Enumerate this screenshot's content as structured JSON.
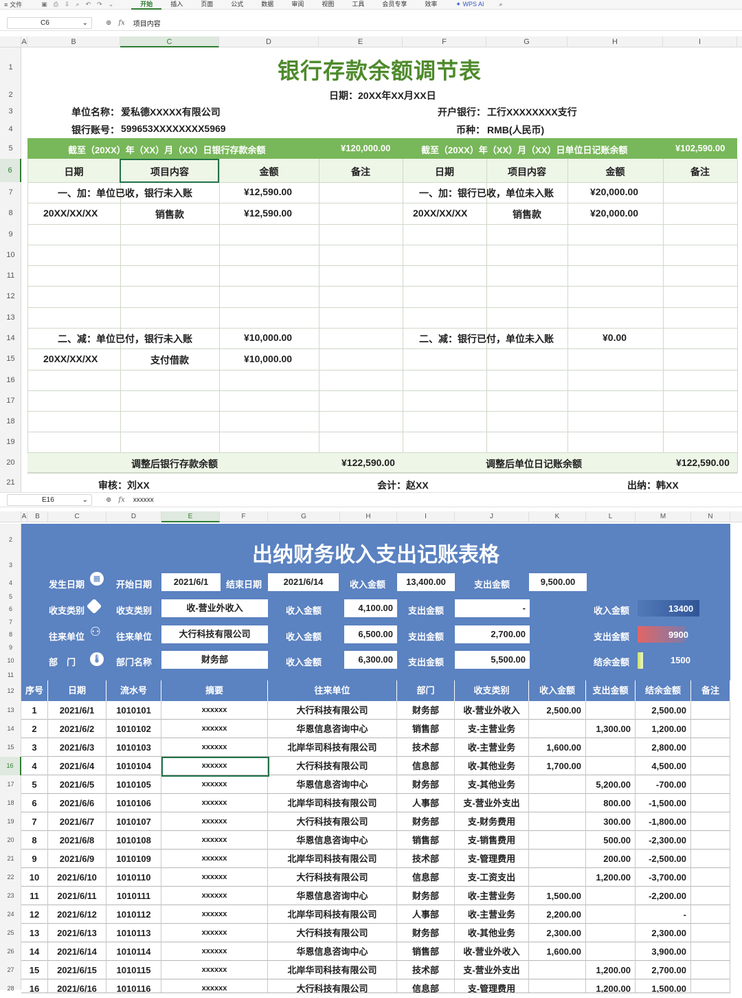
{
  "app": {
    "menu_label": "文件",
    "tabs": [
      "开始",
      "插入",
      "页面",
      "公式",
      "数据",
      "审阅",
      "视图",
      "工具",
      "会员专享",
      "效率"
    ],
    "active_tab": "开始",
    "ai_label": "WPS AI"
  },
  "sheet1": {
    "formula_bar": {
      "cell": "C6",
      "content": "项目内容"
    },
    "columns": [
      "A",
      "B",
      "C",
      "D",
      "E",
      "F",
      "G",
      "H",
      "I"
    ],
    "selected_column": "C",
    "rows": [
      "1",
      "2",
      "3",
      "4",
      "5",
      "6",
      "7",
      "8",
      "9",
      "10",
      "11",
      "12",
      "13",
      "14",
      "15",
      "16",
      "17",
      "18",
      "19",
      "20",
      "21"
    ],
    "selected_row": "6",
    "title": "银行存款余额调节表",
    "date_line": "日期：20XX年XX月XX日",
    "company_label": "单位名称：",
    "company_value": "爱私德XXXXX有限公司",
    "account_label": "银行账号：",
    "account_value": "599653XXXXXXXX5969",
    "bank_label": "开户银行：",
    "bank_value": "工行XXXXXXXX支行",
    "currency_label": "币种：",
    "currency_value": "RMB(人民币)",
    "bank_balance_label": "截至（20XX）年（XX）月（XX）日银行存款余额",
    "bank_balance_value": "¥120,000.00",
    "book_balance_label": "截至（20XX）年（XX）月（XX）日单位日记账余额",
    "book_balance_value": "¥102,590.00",
    "headers": [
      "日期",
      "项目内容",
      "金额",
      "备注",
      "日期",
      "项目内容",
      "金额",
      "备注"
    ],
    "add_left": "一、加：单位已收，银行未入账",
    "add_left_amount": "¥12,590.00",
    "add_right": "一、加：银行已收，单位未入账",
    "add_right_amount": "¥20,000.00",
    "row8": {
      "date_l": "20XX/XX/XX",
      "item_l": "销售款",
      "amt_l": "¥12,590.00",
      "date_r": "20XX/XX/XX",
      "item_r": "销售款",
      "amt_r": "¥20,000.00"
    },
    "sub_left": "二、减：单位已付，银行未入账",
    "sub_left_amount": "¥10,000.00",
    "sub_right": "二、减：银行已付，单位未入账",
    "sub_right_amount": "¥0.00",
    "row15": {
      "date_l": "20XX/XX/XX",
      "item_l": "支付借款",
      "amt_l": "¥10,000.00"
    },
    "adj_bank_label": "调整后银行存款余额",
    "adj_bank_value": "¥122,590.00",
    "adj_book_label": "调整后单位日记账余额",
    "adj_book_value": "¥122,590.00",
    "audit": "审核：刘XX",
    "accountant": "会计：赵XX",
    "cashier": "出纳：韩XX"
  },
  "sheet2": {
    "formula_bar": {
      "cell": "E16",
      "content": "xxxxxx"
    },
    "columns": [
      "A",
      "B",
      "C",
      "D",
      "E",
      "F",
      "G",
      "H",
      "I",
      "J",
      "K",
      "L",
      "M",
      "N"
    ],
    "selected_column": "E",
    "title": "出纳财务收入支出记账表格",
    "occur_date_label": "发生日期",
    "category_label": "收支类别",
    "partner_label": "往来单位",
    "dept_label": "部　门",
    "start_date_label": "开始日期",
    "start_date": "2021/6/1",
    "end_date_label": "结束日期",
    "end_date": "2021/6/14",
    "income_label": "收入金额",
    "income_total": "13,400.00",
    "expense_label": "支出金额",
    "expense_total": "9,500.00",
    "type_label": "收支类别",
    "type_value": "收-营业外收入",
    "type_income": "4,100.00",
    "type_expense": "-",
    "unit_label": "往来单位",
    "unit_value": "大行科技有限公司",
    "unit_income": "6,500.00",
    "unit_expense": "2,700.00",
    "deptname_label": "部门名称",
    "dept_value": "财务部",
    "dept_income": "6,300.00",
    "dept_expense": "5,500.00",
    "g_income_label": "收入金额",
    "g_income_value": "13400",
    "g_expense_label": "支出金额",
    "g_expense_value": "9900",
    "g_balance_label": "结余金额",
    "g_balance_value": "1500",
    "gauge_colors": {
      "income": "#2f5597",
      "expense": "#e06666",
      "balance": "#c9e265"
    },
    "table_headers": [
      "序号",
      "日期",
      "流水号",
      "摘要",
      "往来单位",
      "部门",
      "收支类别",
      "收入金额",
      "支出金额",
      "结余金额",
      "备注"
    ],
    "row_numbers": [
      "11",
      "12",
      "13",
      "14",
      "15",
      "16",
      "17",
      "18",
      "19",
      "20",
      "21",
      "22",
      "23",
      "24",
      "25",
      "26",
      "27",
      "28"
    ],
    "rows": [
      [
        "1",
        "2021/6/1",
        "1010101",
        "xxxxxx",
        "大行科技有限公司",
        "财务部",
        "收-营业外收入",
        "2,500.00",
        "",
        "2,500.00",
        ""
      ],
      [
        "2",
        "2021/6/2",
        "1010102",
        "xxxxxx",
        "华恩信息咨询中心",
        "销售部",
        "支-主营业务",
        "",
        "1,300.00",
        "1,200.00",
        ""
      ],
      [
        "3",
        "2021/6/3",
        "1010103",
        "xxxxxx",
        "北岸华司科技有限公司",
        "技术部",
        "收-主营业务",
        "1,600.00",
        "",
        "2,800.00",
        ""
      ],
      [
        "4",
        "2021/6/4",
        "1010104",
        "xxxxxx",
        "大行科技有限公司",
        "信息部",
        "收-其他业务",
        "1,700.00",
        "",
        "4,500.00",
        ""
      ],
      [
        "5",
        "2021/6/5",
        "1010105",
        "xxxxxx",
        "华恩信息咨询中心",
        "财务部",
        "支-其他业务",
        "",
        "5,200.00",
        "-700.00",
        ""
      ],
      [
        "6",
        "2021/6/6",
        "1010106",
        "xxxxxx",
        "北岸华司科技有限公司",
        "人事部",
        "支-营业外支出",
        "",
        "800.00",
        "-1,500.00",
        ""
      ],
      [
        "7",
        "2021/6/7",
        "1010107",
        "xxxxxx",
        "大行科技有限公司",
        "财务部",
        "支-财务费用",
        "",
        "300.00",
        "-1,800.00",
        ""
      ],
      [
        "8",
        "2021/6/8",
        "1010108",
        "xxxxxx",
        "华恩信息咨询中心",
        "销售部",
        "支-销售费用",
        "",
        "500.00",
        "-2,300.00",
        ""
      ],
      [
        "9",
        "2021/6/9",
        "1010109",
        "xxxxxx",
        "北岸华司科技有限公司",
        "技术部",
        "支-管理费用",
        "",
        "200.00",
        "-2,500.00",
        ""
      ],
      [
        "10",
        "2021/6/10",
        "1010110",
        "xxxxxx",
        "大行科技有限公司",
        "信息部",
        "支-工资支出",
        "",
        "1,200.00",
        "-3,700.00",
        ""
      ],
      [
        "11",
        "2021/6/11",
        "1010111",
        "xxxxxx",
        "华恩信息咨询中心",
        "财务部",
        "收-主营业务",
        "1,500.00",
        "",
        "-2,200.00",
        ""
      ],
      [
        "12",
        "2021/6/12",
        "1010112",
        "xxxxxx",
        "北岸华司科技有限公司",
        "人事部",
        "收-主营业务",
        "2,200.00",
        "",
        "-",
        ""
      ],
      [
        "13",
        "2021/6/13",
        "1010113",
        "xxxxxx",
        "大行科技有限公司",
        "财务部",
        "收-其他业务",
        "2,300.00",
        "",
        "2,300.00",
        ""
      ],
      [
        "14",
        "2021/6/14",
        "1010114",
        "xxxxxx",
        "华恩信息咨询中心",
        "销售部",
        "收-营业外收入",
        "1,600.00",
        "",
        "3,900.00",
        ""
      ],
      [
        "15",
        "2021/6/15",
        "1010115",
        "xxxxxx",
        "北岸华司科技有限公司",
        "技术部",
        "支-营业外支出",
        "",
        "1,200.00",
        "2,700.00",
        ""
      ],
      [
        "16",
        "2021/6/16",
        "1010116",
        "xxxxxx",
        "大行科技有限公司",
        "信息部",
        "支-管理费用",
        "",
        "1,200.00",
        "1,500.00",
        ""
      ]
    ]
  }
}
